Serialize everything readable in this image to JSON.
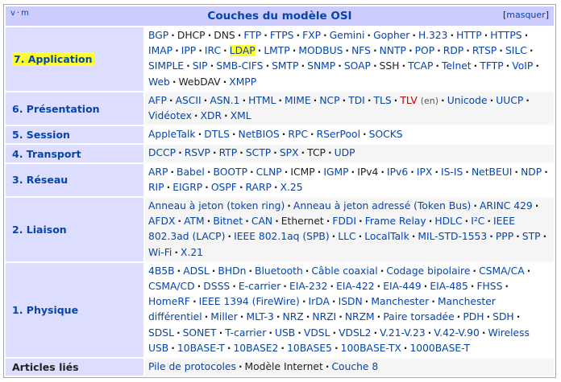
{
  "header": {
    "vm_v": "v",
    "vm_m": "m",
    "title": "Couches du modèle OSI",
    "hide_label": "masquer"
  },
  "rows": [
    {
      "group": "7. Application",
      "highlight": true,
      "items": [
        {
          "t": "BGP"
        },
        {
          "t": "DHCP",
          "s": "self"
        },
        {
          "t": "DNS",
          "s": "self"
        },
        {
          "t": "FTP"
        },
        {
          "t": "FTPS"
        },
        {
          "t": "FXP"
        },
        {
          "t": "Gemini"
        },
        {
          "t": "Gopher"
        },
        {
          "t": "H.323"
        },
        {
          "t": "HTTP"
        },
        {
          "t": "HTTPS"
        },
        {
          "t": "IMAP"
        },
        {
          "t": "IPP"
        },
        {
          "t": "IRC"
        },
        {
          "t": "LDAP",
          "s": "hl"
        },
        {
          "t": "LMTP"
        },
        {
          "t": "MODBUS"
        },
        {
          "t": "NFS"
        },
        {
          "t": "NNTP"
        },
        {
          "t": "POP"
        },
        {
          "t": "RDP"
        },
        {
          "t": "RTSP"
        },
        {
          "t": "SILC"
        },
        {
          "t": "SIMPLE"
        },
        {
          "t": "SIP"
        },
        {
          "t": "SMB-CIFS"
        },
        {
          "t": "SMTP"
        },
        {
          "t": "SNMP"
        },
        {
          "t": "SOAP"
        },
        {
          "t": "SSH",
          "s": "self"
        },
        {
          "t": "TCAP"
        },
        {
          "t": "Telnet"
        },
        {
          "t": "TFTP"
        },
        {
          "t": "VoIP"
        },
        {
          "t": "Web"
        },
        {
          "t": "WebDAV",
          "s": "self"
        },
        {
          "t": "XMPP"
        }
      ]
    },
    {
      "group": "6. Présentation",
      "items": [
        {
          "t": "AFP"
        },
        {
          "t": "ASCII"
        },
        {
          "t": "ASN.1"
        },
        {
          "t": "HTML"
        },
        {
          "t": "MIME"
        },
        {
          "t": "NCP"
        },
        {
          "t": "TDI"
        },
        {
          "t": "TLS"
        },
        {
          "t": "TLV",
          "s": "red",
          "en": "(en)"
        },
        {
          "t": "Unicode"
        },
        {
          "t": "UUCP"
        },
        {
          "t": "Vidéotex"
        },
        {
          "t": "XDR"
        },
        {
          "t": "XML"
        }
      ]
    },
    {
      "group": "5. Session",
      "items": [
        {
          "t": "AppleTalk"
        },
        {
          "t": "DTLS"
        },
        {
          "t": "NetBIOS"
        },
        {
          "t": "RPC"
        },
        {
          "t": "RSerPool"
        },
        {
          "t": "SOCKS"
        }
      ]
    },
    {
      "group": "4. Transport",
      "items": [
        {
          "t": "DCCP"
        },
        {
          "t": "RSVP"
        },
        {
          "t": "RTP"
        },
        {
          "t": "SCTP"
        },
        {
          "t": "SPX"
        },
        {
          "t": "TCP",
          "s": "self"
        },
        {
          "t": "UDP"
        }
      ]
    },
    {
      "group": "3. Réseau",
      "items": [
        {
          "t": "ARP"
        },
        {
          "t": "Babel"
        },
        {
          "t": "BOOTP"
        },
        {
          "t": "CLNP"
        },
        {
          "t": "ICMP",
          "s": "self"
        },
        {
          "t": "IGMP"
        },
        {
          "t": "IPv4",
          "s": "self"
        },
        {
          "t": "IPv6"
        },
        {
          "t": "IPX"
        },
        {
          "t": "IS-IS"
        },
        {
          "t": "NetBEUI"
        },
        {
          "t": "NDP"
        },
        {
          "t": "RIP"
        },
        {
          "t": "EIGRP"
        },
        {
          "t": "OSPF"
        },
        {
          "t": "RARP"
        },
        {
          "t": "X.25"
        }
      ]
    },
    {
      "group": "2. Liaison",
      "items": [
        {
          "t": "Anneau à jeton (token ring)"
        },
        {
          "t": "Anneau à jeton adressé (Token Bus)"
        },
        {
          "t": "ARINC 429"
        },
        {
          "t": "AFDX"
        },
        {
          "t": "ATM"
        },
        {
          "t": "Bitnet"
        },
        {
          "t": "CAN"
        },
        {
          "t": "Ethernet",
          "s": "self"
        },
        {
          "t": "FDDI"
        },
        {
          "t": "Frame Relay"
        },
        {
          "t": "HDLC"
        },
        {
          "t": "I²C"
        },
        {
          "t": "IEEE 802.3ad (LACP)"
        },
        {
          "t": "IEEE 802.1aq (SPB)"
        },
        {
          "t": "LLC"
        },
        {
          "t": "LocalTalk"
        },
        {
          "t": "MIL-STD-1553"
        },
        {
          "t": "PPP"
        },
        {
          "t": "STP"
        },
        {
          "t": "Wi-Fi"
        },
        {
          "t": "X.21"
        }
      ]
    },
    {
      "group": "1. Physique",
      "items": [
        {
          "t": "4B5B"
        },
        {
          "t": "ADSL"
        },
        {
          "t": "BHDn"
        },
        {
          "t": "Bluetooth"
        },
        {
          "t": "Câble coaxial"
        },
        {
          "t": "Codage bipolaire"
        },
        {
          "t": "CSMA/CA"
        },
        {
          "t": "CSMA/CD"
        },
        {
          "t": "DSSS"
        },
        {
          "t": "E-carrier"
        },
        {
          "t": "EIA-232"
        },
        {
          "t": "EIA-422"
        },
        {
          "t": "EIA-449"
        },
        {
          "t": "EIA-485"
        },
        {
          "t": "FHSS"
        },
        {
          "t": "HomeRF"
        },
        {
          "t": "IEEE 1394 (FireWire)"
        },
        {
          "t": "IrDA"
        },
        {
          "t": "ISDN"
        },
        {
          "t": "Manchester"
        },
        {
          "t": "Manchester différentiel"
        },
        {
          "t": "Miller"
        },
        {
          "t": "MLT-3"
        },
        {
          "t": "NRZ"
        },
        {
          "t": "NRZI"
        },
        {
          "t": "NRZM"
        },
        {
          "t": "Paire torsadée"
        },
        {
          "t": "PDH"
        },
        {
          "t": "SDH"
        },
        {
          "t": "SDSL"
        },
        {
          "t": "SONET"
        },
        {
          "t": "T-carrier"
        },
        {
          "t": "USB"
        },
        {
          "t": "VDSL"
        },
        {
          "t": "VDSL2"
        },
        {
          "t": "V.21-V.23"
        },
        {
          "t": "V.42-V.90"
        },
        {
          "t": "Wireless USB"
        },
        {
          "t": "10BASE-T"
        },
        {
          "t": "10BASE2"
        },
        {
          "t": "10BASE5"
        },
        {
          "t": "100BASE-TX"
        },
        {
          "t": "1000BASE-T"
        }
      ]
    },
    {
      "group": "Articles liés",
      "plain": true,
      "items": [
        {
          "t": "Pile de protocoles"
        },
        {
          "t": "Modèle Internet",
          "s": "self"
        },
        {
          "t": "Couche 8"
        }
      ]
    }
  ],
  "colors": {
    "title_bg": "#ccccff",
    "group_bg": "#ddddff",
    "link": "#0645ad",
    "highlight": "#ffff33",
    "redlink": "#ba0000"
  }
}
